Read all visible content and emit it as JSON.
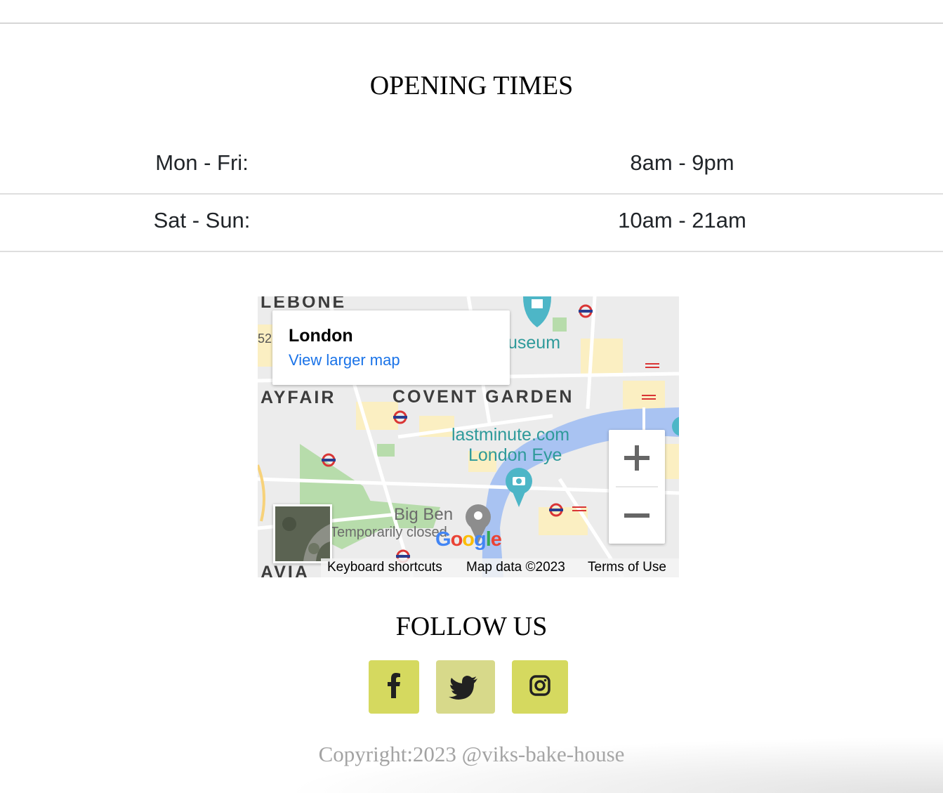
{
  "opening": {
    "title": "OPENING TIMES",
    "rows": [
      {
        "day": "Mon - Fri:",
        "time": "8am - 9pm"
      },
      {
        "day": "Sat - Sun:",
        "time": "10am - 21am"
      }
    ]
  },
  "map": {
    "place": "London",
    "larger_map_link": "View larger map",
    "labels": {
      "marylebone": "LEBONE",
      "museum": "useum",
      "mayfair": "AYFAIR",
      "covent_garden": "COVENT GARDEN",
      "eye_line1": "lastminute.com",
      "eye_line2": "London Eye",
      "big_ben": "Big Ben",
      "big_ben_status": "Temporarily closed",
      "belgravia": "AVIA",
      "road_number": "52"
    },
    "logo": "Google",
    "keyboard_shortcuts": "Keyboard shortcuts",
    "map_data": "Map data ©2023",
    "terms": "Terms of Use",
    "zoom_in_icon": "plus-icon",
    "zoom_out_icon": "minus-icon",
    "colors": {
      "water": "#a9c3f2",
      "park": "#b7dcab",
      "poi": "#4db6c7"
    }
  },
  "follow": {
    "title": "FOLLOW US",
    "icons": [
      {
        "name": "facebook-icon",
        "color": "#d5d95f"
      },
      {
        "name": "twitter-icon",
        "color": "#d7d98a"
      },
      {
        "name": "instagram-icon",
        "color": "#d5d95f"
      }
    ]
  },
  "copyright": "Copyright:2023 @viks-bake-house"
}
